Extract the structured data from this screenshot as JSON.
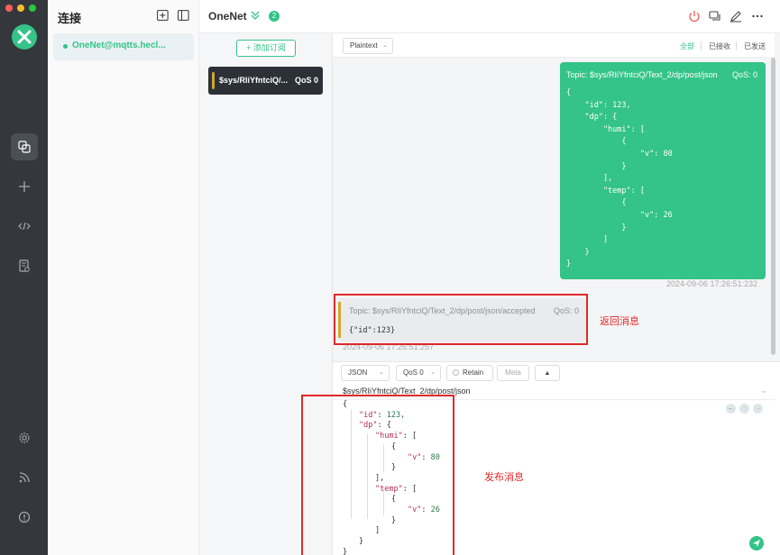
{
  "sidebar": {
    "traffic_lights": [
      "#ff5f57",
      "#febc2e",
      "#28c840"
    ],
    "logo": "mqttx-logo",
    "nav_icons": [
      "connections-icon",
      "add-icon",
      "script-icon",
      "log-icon",
      "settings-icon",
      "feed-icon",
      "info-icon"
    ]
  },
  "connections": {
    "title": "连接",
    "items": [
      {
        "name": "OneNet@mqtts.hecl...",
        "status": "connected"
      }
    ]
  },
  "header": {
    "title": "OneNet",
    "badge": "2"
  },
  "subscriptions": {
    "add_label": "+ 添加订阅",
    "items": [
      {
        "topic": "$sys/RIiYfntciQ/...",
        "qos": "QoS 0",
        "color": "#d4a62a"
      }
    ]
  },
  "messages": {
    "format": "Plaintext",
    "filters": [
      "全部",
      "已接收",
      "已发送"
    ],
    "sent": {
      "topic": "Topic: $sys/RIiYfntciQ/Text_2/dp/post/json",
      "qos": "QoS: 0",
      "payload": "{\n    \"id\": 123,\n    \"dp\": {\n        \"humi\": [\n            {\n                \"v\": 80\n            }\n        ],\n        \"temp\": [\n            {\n                \"v\": 26\n            }\n        ]\n    }\n}",
      "time": "2024-09-06 17:26:51:232"
    },
    "received": {
      "topic": "Topic: $sys/RIiYfntciQ/Text_2/dp/post/json/accepted",
      "qos": "QoS: 0",
      "payload": "{\"id\":123}",
      "time": "2024-09-06 17:26:51:257",
      "annotation": "返回消息"
    }
  },
  "publish": {
    "format": "JSON",
    "qos": "QoS 0",
    "retain": "Retain",
    "meta": "Meta",
    "topic": "$sys/RIiYfntciQ/Text_2/dp/post/json",
    "annotation": "发布消息",
    "payload_lines": [
      {
        "indent": 0,
        "text": "{"
      },
      {
        "indent": 1,
        "key": "\"id\"",
        "val": "123,"
      },
      {
        "indent": 1,
        "key": "\"dp\"",
        "val": "{"
      },
      {
        "indent": 2,
        "key": "\"humi\"",
        "val": "["
      },
      {
        "indent": 3,
        "text": "{"
      },
      {
        "indent": 4,
        "key": "\"v\"",
        "val": "80"
      },
      {
        "indent": 3,
        "text": "}"
      },
      {
        "indent": 2,
        "text": "],"
      },
      {
        "indent": 2,
        "key": "\"temp\"",
        "val": "["
      },
      {
        "indent": 3,
        "text": "{"
      },
      {
        "indent": 4,
        "key": "\"v\"",
        "val": "26"
      },
      {
        "indent": 3,
        "text": "}"
      },
      {
        "indent": 2,
        "text": "]"
      },
      {
        "indent": 1,
        "text": "}"
      },
      {
        "indent": 0,
        "text": "}"
      }
    ]
  },
  "colors": {
    "accent": "#34c388",
    "sidebar_bg": "#34383d",
    "highlight": "#e02828"
  }
}
